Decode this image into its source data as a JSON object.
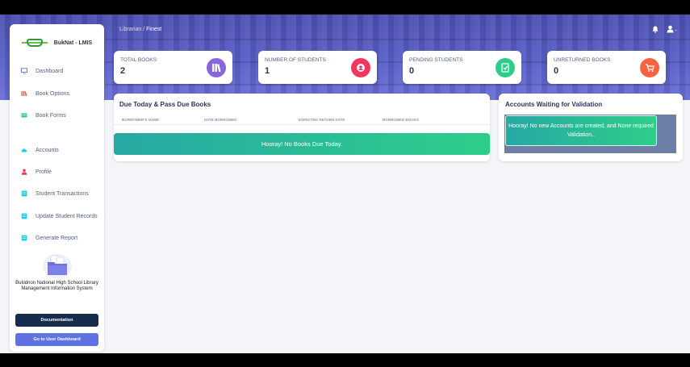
{
  "app": {
    "name": "BukNat - LMIS"
  },
  "breadcrumb": {
    "parent": "Librarian",
    "separator": "/",
    "current": "Finest"
  },
  "sidebar": {
    "items": [
      {
        "label": "Dashboard",
        "icon": "monitor-icon",
        "color": "#5e72e4"
      },
      {
        "label": "Book Options",
        "icon": "books-icon",
        "color": "#fb6340"
      },
      {
        "label": "Book Forms",
        "icon": "form-icon",
        "color": "#2dce89"
      },
      {
        "label": "Accounts",
        "icon": "cloud-icon",
        "color": "#11cdef"
      },
      {
        "label": "Profile",
        "icon": "person-icon",
        "color": "#f5365c"
      },
      {
        "label": "Student Transactions",
        "icon": "ledger-icon",
        "color": "#11cdef"
      },
      {
        "label": "Update Student Records",
        "icon": "ledger-icon",
        "color": "#11cdef"
      },
      {
        "label": "Generate Report",
        "icon": "ledger-icon",
        "color": "#11cdef"
      }
    ],
    "school": "Bukidnon National High School Library Management Information System",
    "doc_button": "Documentation",
    "user_button": "Go to User Dashboard"
  },
  "stats": [
    {
      "label": "TOTAL BOOKS",
      "value": "2",
      "color": "#8965e0",
      "icon": "books-icon"
    },
    {
      "label": "NUMBER OF STUDENTS",
      "value": "1",
      "color": "#f5365c",
      "icon": "student-icon"
    },
    {
      "label": "PENDING STUDENTS",
      "value": "0",
      "color": "#2dce89",
      "icon": "clipboard-icon"
    },
    {
      "label": "UNRETURNED BOOKS",
      "value": "0",
      "color": "#fb6340",
      "icon": "cart-icon"
    }
  ],
  "due_panel": {
    "title": "Due Today & Pass Due Books",
    "columns": [
      "BORROWER'S NAME",
      "DATE BORROWED",
      "EXPECTED RETURN DATE",
      "BORROWED BOOKS"
    ],
    "empty_message": "Hooray! No Books Due Today."
  },
  "validation_panel": {
    "title": "Accounts Waiting for Validation",
    "message": "Hooray! No new Accounts are created, and None required Validation.."
  },
  "colors": {
    "accent": "#5e72e4",
    "dark": "#172b4d",
    "success": "#2dce89"
  }
}
